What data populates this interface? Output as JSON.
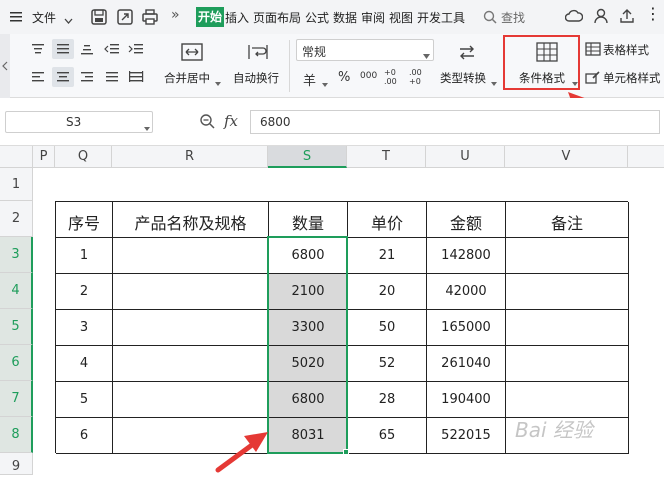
{
  "menubar": {
    "file_label": "文件",
    "tabs": [
      "开始",
      "插入",
      "页面布局",
      "公式",
      "数据",
      "审阅",
      "视图",
      "开发工具"
    ],
    "search_label": "查找"
  },
  "ribbon": {
    "merge_label": "合并居中",
    "wrap_label": "自动换行",
    "number_format_value": "常规",
    "currency_symbol": "羊",
    "percent_symbol": "%",
    "thousands_symbol": "000",
    "inc_decimal_symbol": "+0 .00",
    "dec_decimal_symbol": ".00 +0",
    "convert_label": "类型转换",
    "cond_format_label": "条件格式",
    "table_style_label": "表格样式",
    "cell_style_label": "单元格样式"
  },
  "formula_bar": {
    "name_box": "S3",
    "fx_label": "fx",
    "value": "6800"
  },
  "columns": [
    "P",
    "Q",
    "R",
    "S",
    "T",
    "U",
    "V"
  ],
  "rows": [
    "1",
    "2",
    "3",
    "4",
    "5",
    "6",
    "7",
    "8",
    "9"
  ],
  "table": {
    "headers": [
      "序号",
      "产品名称及规格",
      "数量",
      "单价",
      "金额",
      "备注"
    ],
    "rows": [
      [
        "1",
        "",
        "6800",
        "21",
        "142800",
        ""
      ],
      [
        "2",
        "",
        "2100",
        "20",
        "42000",
        ""
      ],
      [
        "3",
        "",
        "3300",
        "50",
        "165000",
        ""
      ],
      [
        "4",
        "",
        "5020",
        "52",
        "261040",
        ""
      ],
      [
        "5",
        "",
        "6800",
        "28",
        "190400",
        ""
      ],
      [
        "6",
        "",
        "8031",
        "65",
        "522015",
        ""
      ]
    ]
  },
  "watermark": "Bai 经验",
  "colors": {
    "accent_green": "#1e9d5b",
    "highlight_red": "#e53935",
    "selection_fill": "#d9d9d9"
  }
}
